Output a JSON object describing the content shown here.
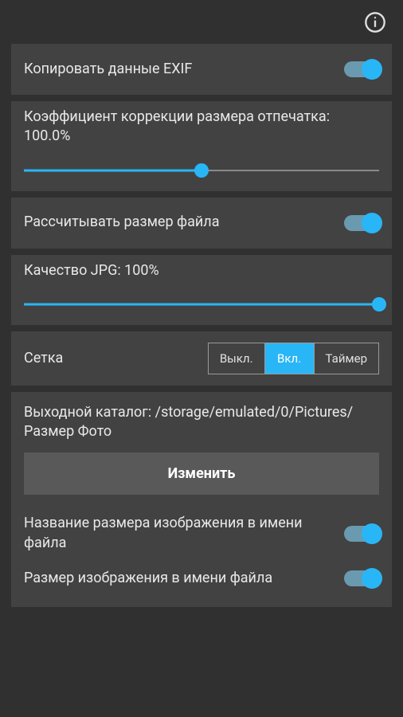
{
  "header": {
    "info_icon": "info-icon"
  },
  "settings": {
    "exif": {
      "label": "Копировать данные EXIF",
      "enabled": true
    },
    "correction": {
      "label": "Коэффициент коррекции размера отпечатка: 100.0%",
      "value_percent": 50
    },
    "filesize": {
      "label": "Рассчитывать размер файла",
      "enabled": true
    },
    "jpg_quality": {
      "label": "Качество JPG: 100%",
      "value_percent": 100
    },
    "grid": {
      "label": "Сетка",
      "options": [
        "Выкл.",
        "Вкл.",
        "Таймер"
      ],
      "selected_index": 1
    },
    "output": {
      "catalog_label": "Выходной каталог: /storage/emulated/0/Pictures/Размер Фото",
      "change_button": "Изменить",
      "name_in_filename": {
        "label": "Название размера изображения в имени файла",
        "enabled": true
      },
      "size_in_filename": {
        "label": "Размер изображения в имени файла",
        "enabled": true
      }
    }
  }
}
